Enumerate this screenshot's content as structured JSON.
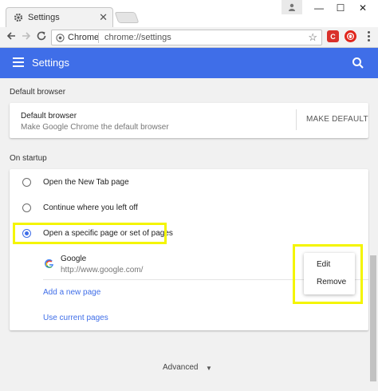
{
  "browser": {
    "tab_title": "Settings",
    "tab_close": "✕",
    "window_controls": {
      "minimize": "—",
      "maximize": "☐",
      "close": "✕"
    },
    "omnibox": {
      "chip": "Chrome",
      "url": "chrome://settings"
    },
    "extensions": [
      {
        "name": "red-shield-extension",
        "glyph": "C",
        "color": "#d9312b"
      },
      {
        "name": "opera-extension",
        "glyph": "O",
        "color": "#e0251b"
      }
    ]
  },
  "header": {
    "title": "Settings",
    "color": "#3f6ee8"
  },
  "default_browser": {
    "section_title": "Default browser",
    "title": "Default browser",
    "subtitle": "Make Google Chrome the default browser",
    "button": "MAKE DEFAULT"
  },
  "on_startup": {
    "section_title": "On startup",
    "options": [
      {
        "label": "Open the New Tab page",
        "checked": false
      },
      {
        "label": "Continue where you left off",
        "checked": false
      },
      {
        "label": "Open a specific page or set of pages",
        "checked": true
      }
    ],
    "pages": [
      {
        "name": "Google",
        "url": "http://www.google.com/"
      }
    ],
    "add_page": "Add a new page",
    "use_current": "Use current pages"
  },
  "context_menu": {
    "items": [
      "Edit",
      "Remove"
    ]
  },
  "advanced": "Advanced",
  "highlight_color": "#f4f500"
}
